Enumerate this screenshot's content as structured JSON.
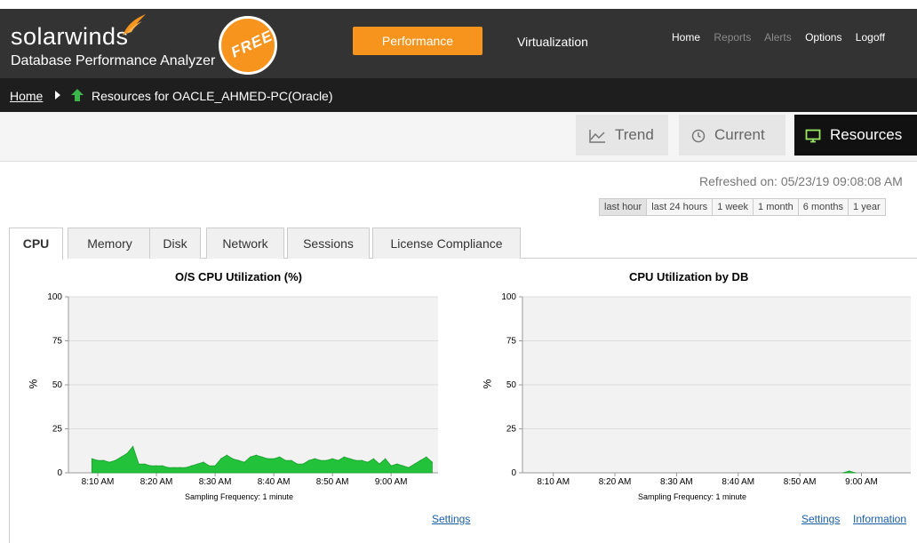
{
  "header": {
    "logo": "solarwinds",
    "product": "Database Performance Analyzer",
    "badge": "FREE",
    "main_tabs": [
      "Performance",
      "Virtualization"
    ],
    "nav": [
      {
        "label": "Home",
        "enabled": true
      },
      {
        "label": "Reports",
        "enabled": false
      },
      {
        "label": "Alerts",
        "enabled": false
      },
      {
        "label": "Options",
        "enabled": true
      },
      {
        "label": "Logoff",
        "enabled": true
      }
    ]
  },
  "breadcrumb": {
    "home": "Home",
    "current": "Resources for OACLE_AHMED-PC(Oracle)"
  },
  "view_tabs": [
    "Trend",
    "Current",
    "Resources"
  ],
  "refreshed": "Refreshed on: 05/23/19 09:08:08 AM",
  "time_ranges": [
    "last hour",
    "last 24 hours",
    "1 week",
    "1 month",
    "6 months",
    "1 year"
  ],
  "resource_tabs": [
    "CPU",
    "Memory",
    "Disk",
    "Network",
    "Sessions",
    "License Compliance"
  ],
  "colors": {
    "accent": "#f7941d",
    "header_bg": "#333333",
    "chart_fill": "#22c33a"
  },
  "chart_data": [
    {
      "type": "area",
      "title": "O/S CPU Utilization (%)",
      "xlabel": "Sampling Frequency: 1 minute",
      "ylabel": "%",
      "ylim": [
        0,
        100
      ],
      "yticks": [
        0,
        25,
        50,
        75,
        100
      ],
      "xtick_labels": [
        "8:10 AM",
        "8:20 AM",
        "8:30 AM",
        "8:40 AM",
        "8:50 AM",
        "9:00 AM"
      ],
      "x": [
        "8:09 AM",
        "8:10 AM",
        "8:11 AM",
        "8:12 AM",
        "8:13 AM",
        "8:14 AM",
        "8:15 AM",
        "8:16 AM",
        "8:17 AM",
        "8:18 AM",
        "8:19 AM",
        "8:20 AM",
        "8:21 AM",
        "8:22 AM",
        "8:23 AM",
        "8:24 AM",
        "8:25 AM",
        "8:26 AM",
        "8:27 AM",
        "8:28 AM",
        "8:29 AM",
        "8:30 AM",
        "8:31 AM",
        "8:32 AM",
        "8:33 AM",
        "8:34 AM",
        "8:35 AM",
        "8:36 AM",
        "8:37 AM",
        "8:38 AM",
        "8:39 AM",
        "8:40 AM",
        "8:41 AM",
        "8:42 AM",
        "8:43 AM",
        "8:44 AM",
        "8:45 AM",
        "8:46 AM",
        "8:47 AM",
        "8:48 AM",
        "8:49 AM",
        "8:50 AM",
        "8:51 AM",
        "8:52 AM",
        "8:53 AM",
        "8:54 AM",
        "8:55 AM",
        "8:56 AM",
        "8:57 AM",
        "8:58 AM",
        "8:59 AM",
        "9:00 AM",
        "9:01 AM",
        "9:02 AM",
        "9:03 AM",
        "9:04 AM",
        "9:05 AM",
        "9:06 AM",
        "9:07 AM"
      ],
      "series": [
        {
          "values": [
            8,
            7,
            7,
            6,
            7,
            9,
            11,
            15,
            5,
            5,
            4,
            4,
            4,
            3,
            3,
            3,
            3,
            4,
            5,
            6,
            4,
            4,
            8,
            10,
            8,
            7,
            6,
            9,
            10,
            9,
            8,
            8,
            9,
            7,
            7,
            5,
            5,
            7,
            8,
            7,
            7,
            8,
            7,
            9,
            8,
            7,
            7,
            6,
            8,
            5,
            8,
            4,
            5,
            4,
            3,
            5,
            7,
            9,
            6
          ]
        }
      ]
    },
    {
      "type": "area",
      "title": "CPU Utilization by DB",
      "xlabel": "Sampling Frequency: 1 minute",
      "ylabel": "%",
      "ylim": [
        0,
        100
      ],
      "yticks": [
        0,
        25,
        50,
        75,
        100
      ],
      "xtick_labels": [
        "8:10 AM",
        "8:20 AM",
        "8:30 AM",
        "8:40 AM",
        "8:50 AM",
        "9:00 AM"
      ],
      "x": [
        "8:57 AM",
        "8:58 AM",
        "8:59 AM"
      ],
      "series": [
        {
          "values": [
            0,
            1,
            0
          ]
        }
      ]
    }
  ],
  "chart_links": {
    "left": [
      "Settings"
    ],
    "right": [
      "Settings",
      "Information"
    ]
  }
}
